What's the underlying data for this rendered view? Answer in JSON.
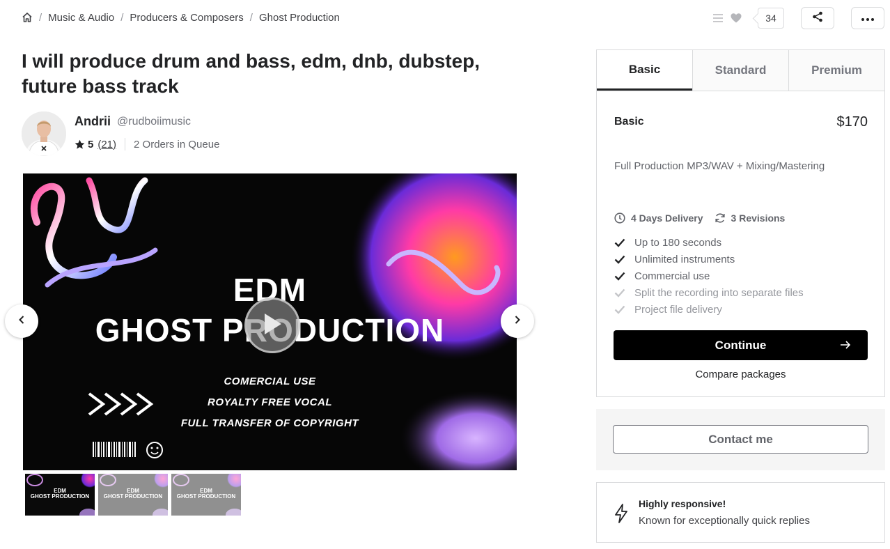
{
  "breadcrumb": {
    "home_icon": "home-icon",
    "items": [
      "Music & Audio",
      "Producers & Composers",
      "Ghost Production"
    ]
  },
  "actions": {
    "collections_icon": "list-icon",
    "like_icon": "heart-icon",
    "like_count": "34",
    "share_icon": "share-icon",
    "more_icon": "more-icon"
  },
  "gig": {
    "title": "I will produce drum and bass, edm, dnb, dubstep, future bass track"
  },
  "seller": {
    "name": "Andrii",
    "handle": "@rudboiimusic",
    "rating": "5",
    "reviews": "(21)",
    "queue": "2 Orders in Queue"
  },
  "gallery": {
    "line1": "EDM",
    "line2": "GHOST PRODUCTION",
    "sub1": "COMERCIAL USE",
    "sub2": "ROYALTY FREE VOCAL",
    "sub3": "FULL TRANSFER OF COPYRIGHT",
    "thumbs": [
      {
        "line1": "EDM",
        "line2": "GHOST PRODUCTION",
        "active": true
      },
      {
        "line1": "EDM",
        "line2": "GHOST PRODUCTION",
        "active": false
      },
      {
        "line1": "EDM",
        "line2": "GHOST PRODUCTION",
        "active": false
      }
    ]
  },
  "packages": {
    "tabs": [
      "Basic",
      "Standard",
      "Premium"
    ],
    "active_tab": "Basic",
    "name": "Basic",
    "price": "$170",
    "description": "Full Production MP3/WAV + Mixing/Mastering",
    "delivery": "4 Days Delivery",
    "revisions": "3 Revisions",
    "features": [
      {
        "label": "Up to 180 seconds",
        "included": true
      },
      {
        "label": "Unlimited instruments",
        "included": true
      },
      {
        "label": "Commercial use",
        "included": true
      },
      {
        "label": "Split the recording into separate files",
        "included": false
      },
      {
        "label": "Project file delivery",
        "included": false
      }
    ],
    "continue_label": "Continue",
    "compare_label": "Compare packages"
  },
  "contact": {
    "label": "Contact me"
  },
  "responsive": {
    "title": "Highly responsive!",
    "subtitle": "Known for exceptionally quick replies"
  },
  "colors": {
    "text_dark": "#222325",
    "text_muted": "#62646a",
    "border": "#dadbdd",
    "button_bg": "#000000"
  }
}
